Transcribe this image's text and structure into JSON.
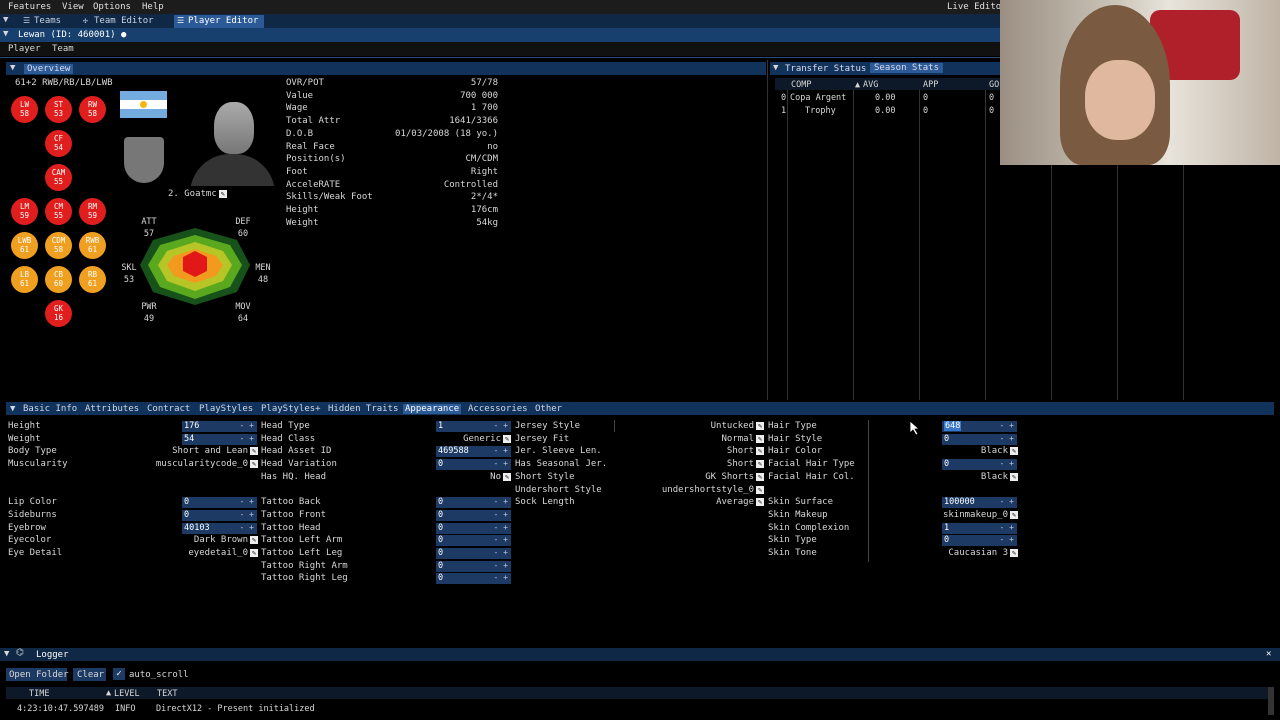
{
  "menu": [
    "Features",
    "View",
    "Options",
    "Help"
  ],
  "live_editor": "Live Edito",
  "nav_tabs": [
    {
      "label": "Teams"
    },
    {
      "label": "Team Editor"
    },
    {
      "label": "Player Editor"
    }
  ],
  "window_title": "Lewan (ID: 460001) ●",
  "subtabs": [
    "Player",
    "Team"
  ],
  "overview": {
    "header": "Overview",
    "summary": "61+2 RWB/RB/LB/LWB",
    "positions": [
      {
        "pos": "LW",
        "val": "58",
        "color": "red"
      },
      {
        "pos": "ST",
        "val": "53",
        "color": "red"
      },
      {
        "pos": "RW",
        "val": "58",
        "color": "red"
      },
      {
        "pos": "CF",
        "val": "54",
        "color": "red"
      },
      {
        "pos": "CAM",
        "val": "55",
        "color": "red"
      },
      {
        "pos": "LM",
        "val": "59",
        "color": "red"
      },
      {
        "pos": "CM",
        "val": "55",
        "color": "red"
      },
      {
        "pos": "RM",
        "val": "59",
        "color": "red"
      },
      {
        "pos": "LWB",
        "val": "61",
        "color": "orange"
      },
      {
        "pos": "CDM",
        "val": "58",
        "color": "orange"
      },
      {
        "pos": "RWB",
        "val": "61",
        "color": "orange"
      },
      {
        "pos": "LB",
        "val": "61",
        "color": "orange"
      },
      {
        "pos": "CB",
        "val": "60",
        "color": "orange"
      },
      {
        "pos": "RB",
        "val": "61",
        "color": "orange"
      },
      {
        "pos": "GK",
        "val": "16",
        "color": "red"
      }
    ],
    "player_label": "2. Goatmc",
    "radar": [
      {
        "k": "ATT",
        "v": "57"
      },
      {
        "k": "DEF",
        "v": "60"
      },
      {
        "k": "SKL",
        "v": "53"
      },
      {
        "k": "MEN",
        "v": "48"
      },
      {
        "k": "PWR",
        "v": "49"
      },
      {
        "k": "MOV",
        "v": "64"
      }
    ],
    "info": [
      {
        "k": "OVR/POT",
        "v": "57/78"
      },
      {
        "k": "Value",
        "v": "700 000"
      },
      {
        "k": "Wage",
        "v": "1 700"
      },
      {
        "k": "Total Attr",
        "v": "1641/3366"
      },
      {
        "k": "D.O.B",
        "v": "01/03/2008 (18 yo.)"
      },
      {
        "k": "Real Face",
        "v": "no"
      },
      {
        "k": "Position(s)",
        "v": "CM/CDM"
      },
      {
        "k": "Foot",
        "v": "Right"
      },
      {
        "k": "AcceleRATE",
        "v": "Controlled"
      },
      {
        "k": "Skills/Weak Foot",
        "v": "2*/4*"
      },
      {
        "k": "Height",
        "v": "176cm"
      },
      {
        "k": "Weight",
        "v": "54kg"
      }
    ]
  },
  "stats": {
    "tabs": [
      "Transfer Status",
      "Season Stats"
    ],
    "columns": [
      "COMP",
      "AVG",
      "APP",
      "GO"
    ],
    "rows": [
      {
        "i": "0",
        "comp": "Copa Argent",
        "avg": "0.00",
        "app": "0",
        "go": "0"
      },
      {
        "i": "1",
        "comp": "Trophy",
        "avg": "0.00",
        "app": "0",
        "go": "0"
      }
    ]
  },
  "editor_tabs": [
    "Basic Info",
    "Attributes",
    "Contract",
    "PlayStyles",
    "PlayStyles+",
    "Hidden Traits",
    "Appearance",
    "Accessories",
    "Other"
  ],
  "col1": [
    {
      "label": "Height",
      "value": "176",
      "type": "num",
      "row": 0
    },
    {
      "label": "Weight",
      "value": "54",
      "type": "num",
      "row": 1
    },
    {
      "label": "Body Type",
      "value": "Short and Lean",
      "type": "edit",
      "row": 2
    },
    {
      "label": "Muscularity",
      "value": "muscularitycode_0",
      "type": "edit",
      "row": 3
    },
    {
      "label": "Lip Color",
      "value": "0",
      "type": "num",
      "row": 6
    },
    {
      "label": "Sideburns",
      "value": "0",
      "type": "num",
      "row": 7
    },
    {
      "label": "Eyebrow",
      "value": "40103",
      "type": "num",
      "row": 8
    },
    {
      "label": "Eyecolor",
      "value": "Dark Brown",
      "type": "edit",
      "row": 9
    },
    {
      "label": "Eye Detail",
      "value": "eyedetail_0",
      "type": "edit",
      "row": 10
    }
  ],
  "col2": [
    {
      "label": "Head Type",
      "value": "1",
      "type": "num",
      "row": 0
    },
    {
      "label": "Head Class",
      "value": "Generic",
      "type": "edit",
      "row": 1
    },
    {
      "label": "Head Asset ID",
      "value": "469588",
      "type": "num",
      "row": 2
    },
    {
      "label": "Head Variation",
      "value": "0",
      "type": "num",
      "row": 3
    },
    {
      "label": "Has HQ. Head",
      "value": "No",
      "type": "edit",
      "row": 4
    },
    {
      "label": "Tattoo Back",
      "value": "0",
      "type": "num",
      "row": 6
    },
    {
      "label": "Tattoo Front",
      "value": "0",
      "type": "num",
      "row": 7
    },
    {
      "label": "Tattoo Head",
      "value": "0",
      "type": "num",
      "row": 8
    },
    {
      "label": "Tattoo Left Arm",
      "value": "0",
      "type": "num",
      "row": 9
    },
    {
      "label": "Tattoo Left Leg",
      "value": "0",
      "type": "num",
      "row": 10
    },
    {
      "label": "Tattoo Right Arm",
      "value": "0",
      "type": "num",
      "row": 11
    },
    {
      "label": "Tattoo Right Leg",
      "value": "0",
      "type": "num",
      "row": 12
    }
  ],
  "col3": [
    {
      "label": "Jersey Style",
      "value": "Untucked",
      "type": "edit",
      "row": 0
    },
    {
      "label": "Jersey Fit",
      "value": "Normal",
      "type": "edit",
      "row": 1
    },
    {
      "label": "Jer. Sleeve Len.",
      "value": "Short",
      "type": "edit",
      "row": 2
    },
    {
      "label": "Has Seasonal Jer.",
      "value": "Short",
      "type": "edit",
      "row": 3
    },
    {
      "label": "Short Style",
      "value": "GK Shorts",
      "type": "edit",
      "row": 4
    },
    {
      "label": "Undershort Style",
      "value": "undershortstyle_0",
      "type": "edit",
      "row": 5
    },
    {
      "label": "Sock Length",
      "value": "Average",
      "type": "edit",
      "row": 6
    }
  ],
  "col4": [
    {
      "label": "Hair Type",
      "value": "648",
      "type": "num",
      "row": 0
    },
    {
      "label": "Hair Style",
      "value": "0",
      "type": "num",
      "row": 1
    },
    {
      "label": "Hair Color",
      "value": "Black",
      "type": "edit",
      "row": 2
    },
    {
      "label": "Facial Hair Type",
      "value": "0",
      "type": "num",
      "row": 3
    },
    {
      "label": "Facial Hair Col.",
      "value": "Black",
      "type": "edit",
      "row": 4
    },
    {
      "label": "Skin Surface",
      "value": "100000",
      "type": "num",
      "row": 6
    },
    {
      "label": "Skin Makeup",
      "value": "skinmakeup_0",
      "type": "edit",
      "row": 7
    },
    {
      "label": "Skin Complexion",
      "value": "1",
      "type": "num",
      "row": 8
    },
    {
      "label": "Skin Type",
      "value": "0",
      "type": "num",
      "row": 9
    },
    {
      "label": "Skin Tone",
      "value": "Caucasian 3",
      "type": "edit",
      "row": 10
    }
  ],
  "logger": {
    "title": "Logger",
    "open_folder": "Open Folder",
    "clear": "Clear",
    "auto_scroll": "auto_scroll",
    "columns": [
      "TIME",
      "LEVEL",
      "TEXT"
    ],
    "entry": {
      "time": "4:23:10:47.597489",
      "level": "INFO",
      "text": "DirectX12 - Present initialized"
    }
  },
  "colors": {
    "accent": "#2c5a96",
    "header": "#11325a",
    "red_pos": "#e01e1e",
    "orange_pos": "#f0a020"
  }
}
